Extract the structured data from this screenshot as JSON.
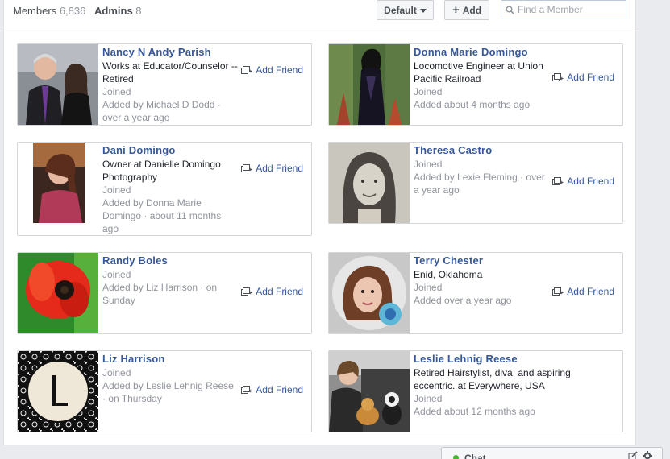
{
  "tabs": {
    "members_label": "Members",
    "members_count": "6,836",
    "admins_label": "Admins",
    "admins_count": "8"
  },
  "toolbar": {
    "sort_label": "Default",
    "add_label": "Add",
    "search_placeholder": "Find a Member"
  },
  "add_friend_label": "Add Friend",
  "members": [
    {
      "name": "Nancy N Andy Parish",
      "lines": [
        "Works at Educator/Counselor --",
        "Retired"
      ],
      "muted": [
        "Joined",
        "Added by Michael D Dodd ·",
        "over a year ago"
      ]
    },
    {
      "name": "Donna Marie Domingo",
      "lines": [
        "Locomotive Engineer at Union",
        "Pacific Railroad"
      ],
      "muted": [
        "Joined",
        "Added about 4 months ago"
      ]
    },
    {
      "name": "Dani Domingo",
      "lines": [
        "Owner at Danielle Domingo",
        "Photography"
      ],
      "muted": [
        "Joined",
        "Added by Donna Marie",
        "Domingo · about 11 months",
        "ago"
      ]
    },
    {
      "name": "Theresa Castro",
      "lines": [],
      "muted": [
        "Joined",
        "Added by Lexie Fleming · over",
        "a year ago"
      ]
    },
    {
      "name": "Randy Boles",
      "lines": [],
      "muted": [
        "Joined",
        "Added by Liz Harrison · on",
        "Sunday"
      ]
    },
    {
      "name": "Terry Chester",
      "lines": [
        "Enid, Oklahoma"
      ],
      "muted": [
        "Joined",
        "Added over a year ago"
      ]
    },
    {
      "name": "Liz Harrison",
      "lines": [],
      "muted": [
        "Joined",
        "Added by Leslie Lehnig Reese",
        "· on Thursday"
      ]
    },
    {
      "name": "Leslie Lehnig Reese",
      "lines": [
        "Retired Hairstylist, diva, and aspiring",
        "eccentric. at Everywhere, USA"
      ],
      "muted": [
        "Joined",
        "Added about 12 months ago"
      ]
    }
  ],
  "chat": {
    "label": "Chat"
  },
  "colors": {
    "link": "#365899",
    "muted": "#90949c",
    "online": "#42b72a"
  }
}
